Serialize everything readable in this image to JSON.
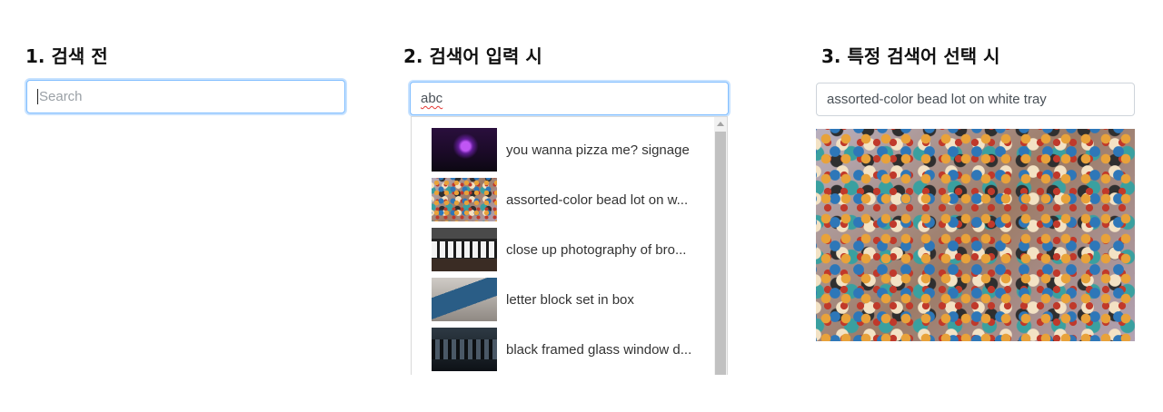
{
  "panels": [
    {
      "title": "1. 검색 전",
      "input_placeholder": "Search"
    },
    {
      "title": "2. 검색어 입력 시",
      "input_value": "abc",
      "suggestions": [
        {
          "label": "you wanna pizza me? signage",
          "thumb_icon": "neon-sign-thumbnail"
        },
        {
          "label": "assorted-color bead lot on w...",
          "thumb_icon": "beads-thumbnail"
        },
        {
          "label": "close up photography of bro...",
          "thumb_icon": "film-strip-thumbnail"
        },
        {
          "label": "letter block set in box",
          "thumb_icon": "letter-box-thumbnail"
        },
        {
          "label": "black framed glass window d...",
          "thumb_icon": "window-thumbnail"
        }
      ]
    },
    {
      "title": "3. 특정 검색어 선택 시",
      "input_value": "assorted-color bead lot on white tray",
      "image_icon": "beads-photo"
    }
  ],
  "colors": {
    "focus_border": "#80bdff",
    "input_border": "#ced4da",
    "spellcheck_underline": "#e53935"
  }
}
